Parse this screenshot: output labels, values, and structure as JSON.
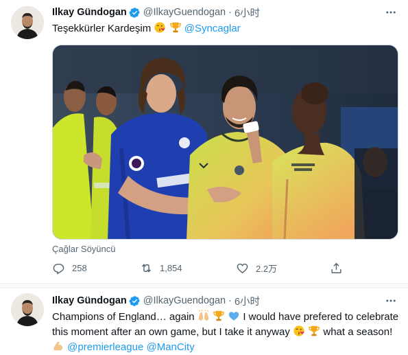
{
  "tweets": [
    {
      "author": {
        "name": "Ilkay Gündogan",
        "handle": "@IlkayGuendogan",
        "verified": true
      },
      "time": "6小时",
      "text": "Teşekkürler Kardeşim",
      "mention": "@Syncaglar",
      "emojis": [
        "kissing-face-with-heart-emoji",
        "trophy-emoji"
      ],
      "media_caption": "Çağlar Söyüncü",
      "actions": {
        "replies": "258",
        "retweets": "1,854",
        "likes": "2.2万"
      }
    },
    {
      "author": {
        "name": "Ilkay Gündogan",
        "handle": "@IlkayGuendogan",
        "verified": true
      },
      "time": "6小时",
      "lines": [
        {
          "a": "Champions of England… again",
          "b": "I would have prefered to celebrate"
        },
        {
          "a": "this moment after an own game, but I take it anyway",
          "b": "what a season!"
        }
      ],
      "mentions": [
        "@premierleague",
        "@ManCity"
      ],
      "emojis": [
        "raising-hands-emoji",
        "trophy-emoji",
        "blue-heart-emoji",
        "kissing-face-with-heart-emoji",
        "trophy-emoji",
        "flexed-biceps-emoji"
      ]
    }
  ],
  "separator": "·",
  "colors": {
    "accent": "#1d9bf0",
    "secondary_text": "#536471",
    "primary_text": "#0f1419"
  }
}
